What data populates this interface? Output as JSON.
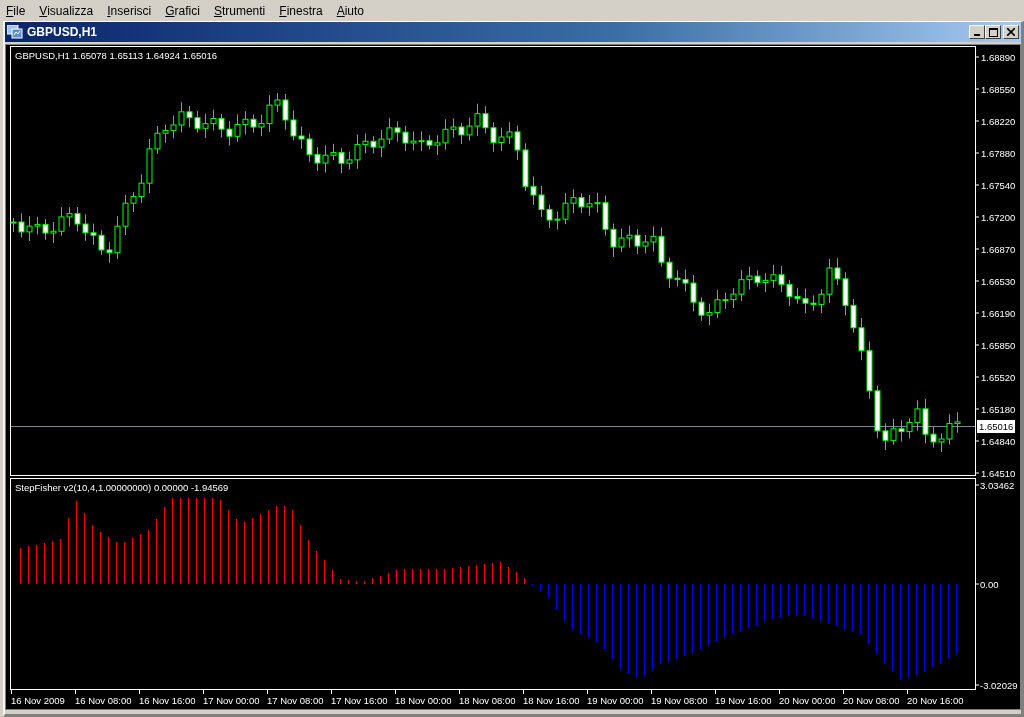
{
  "menu": [
    {
      "label": "File"
    },
    {
      "label": "Visualizza"
    },
    {
      "label": "Inserisci"
    },
    {
      "label": "Grafici"
    },
    {
      "label": "Strumenti"
    },
    {
      "label": "Finestra"
    },
    {
      "label": "Aiuto"
    }
  ],
  "window": {
    "title": "GBPUSD,H1"
  },
  "chart": {
    "info": "GBPUSD,H1  1.65078 1.65113 1.64924 1.65016",
    "price_axis": [
      "1.68890",
      "1.68550",
      "1.68220",
      "1.67880",
      "1.67540",
      "1.67200",
      "1.66870",
      "1.66530",
      "1.66190",
      "1.65850",
      "1.65520",
      "1.65180",
      "1.64840",
      "1.64510"
    ],
    "current_price": "1.65016"
  },
  "indicator": {
    "info": "StepFisher v2(10,4,1.00000000) 0.00000 -1.94569",
    "axis": [
      "3.03462",
      "0.00",
      "-3.02029"
    ]
  },
  "time_axis": [
    "16 Nov 2009",
    "16 Nov 08:00",
    "16 Nov 16:00",
    "17 Nov 00:00",
    "17 Nov 08:00",
    "17 Nov 16:00",
    "18 Nov 00:00",
    "18 Nov 08:00",
    "18 Nov 16:00",
    "19 Nov 00:00",
    "19 Nov 08:00",
    "19 Nov 16:00",
    "20 Nov 00:00",
    "20 Nov 08:00",
    "20 Nov 16:00"
  ]
}
